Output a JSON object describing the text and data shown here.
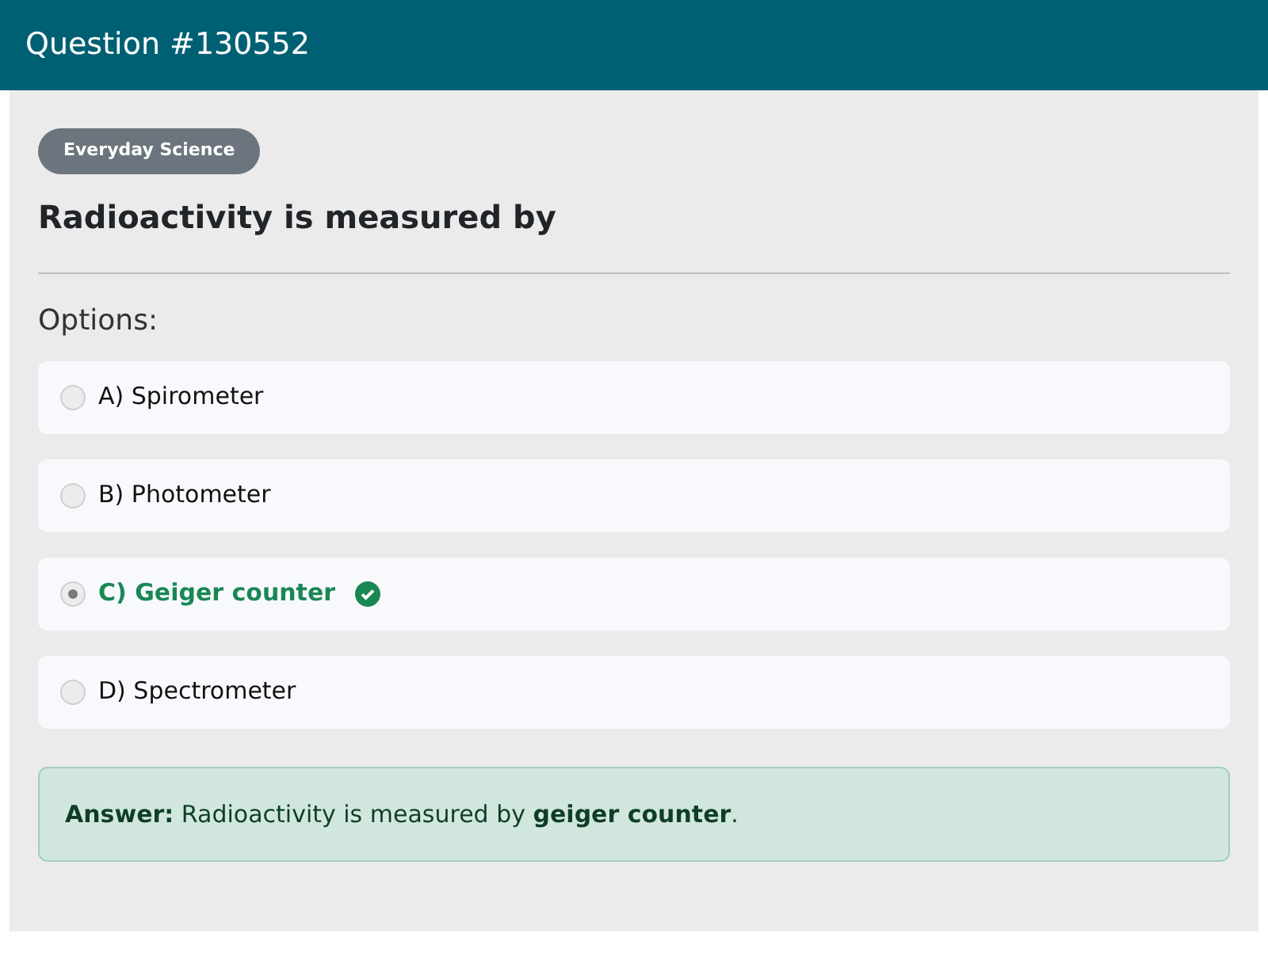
{
  "header": {
    "title": "Question #130552"
  },
  "category": "Everyday Science",
  "question": "Radioactivity is measured by",
  "options_label": "Options:",
  "options": [
    {
      "label": "A) Spirometer",
      "selected": false,
      "correct": false
    },
    {
      "label": "B) Photometer",
      "selected": false,
      "correct": false
    },
    {
      "label": "C) Geiger counter",
      "selected": true,
      "correct": true
    },
    {
      "label": "D) Spectrometer",
      "selected": false,
      "correct": false
    }
  ],
  "answer": "**Answer:** Radioactivity is measured by **geiger counter**."
}
